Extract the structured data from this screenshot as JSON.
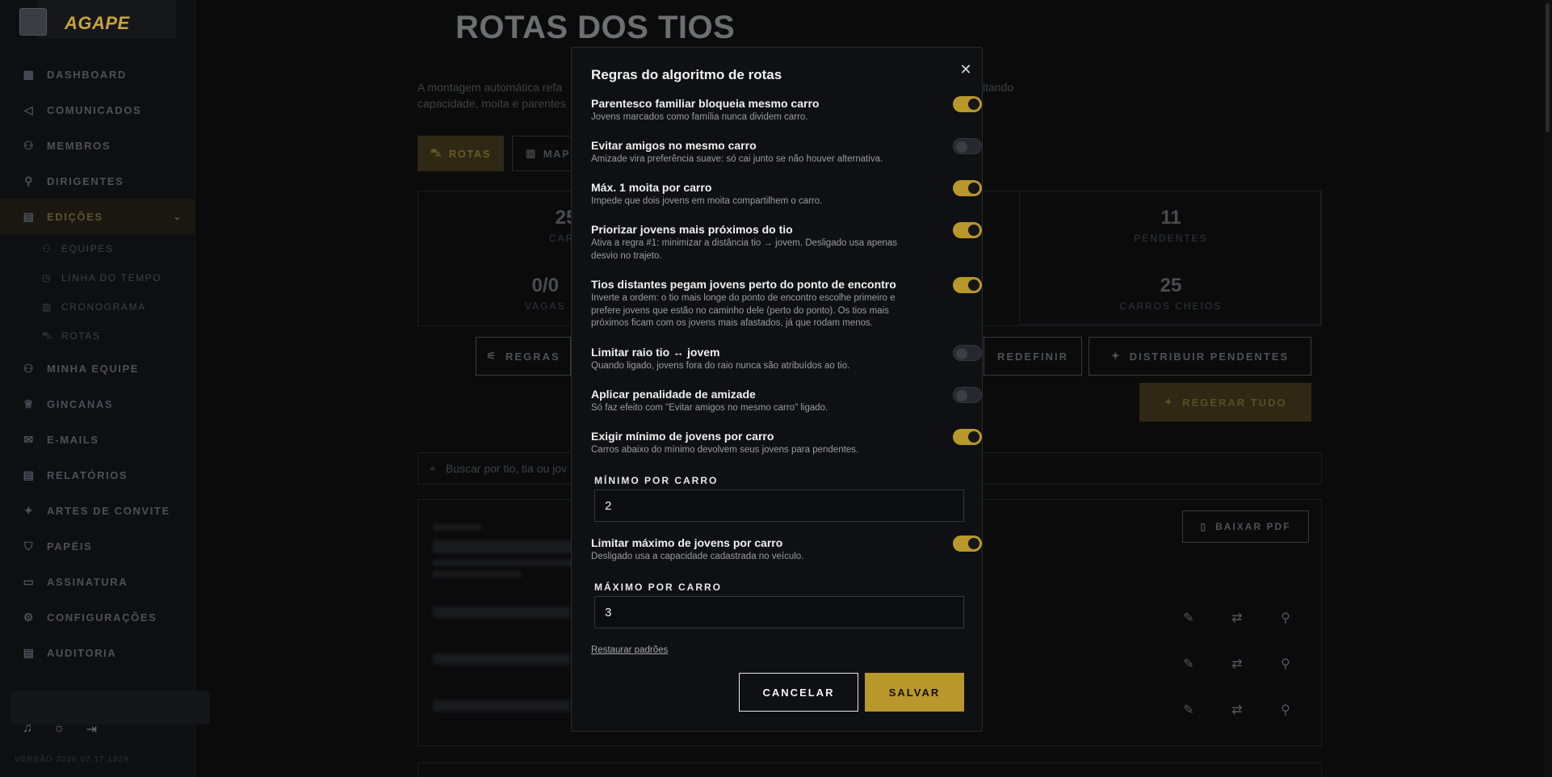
{
  "sidebar": {
    "brand": "AGAPE",
    "items": [
      {
        "label": "DASHBOARD",
        "icon": "grid-icon"
      },
      {
        "label": "COMUNICADOS",
        "icon": "megaphone-icon"
      },
      {
        "label": "MEMBROS",
        "icon": "users-icon"
      },
      {
        "label": "DIRIGENTES",
        "icon": "user-key-icon"
      },
      {
        "label": "EDIÇÕES",
        "icon": "calendar-icon"
      },
      {
        "label": "MINHA EQUIPE",
        "icon": "users-icon"
      },
      {
        "label": "GINCANAS",
        "icon": "trophy-icon"
      },
      {
        "label": "E-MAILS",
        "icon": "mail-icon"
      },
      {
        "label": "RELATÓRIOS",
        "icon": "report-icon"
      },
      {
        "label": "ARTES DE CONVITE",
        "icon": "sparkles-icon"
      },
      {
        "label": "PAPÉIS",
        "icon": "shield-icon"
      },
      {
        "label": "ASSINATURA",
        "icon": "card-icon"
      },
      {
        "label": "CONFIGURAÇÕES",
        "icon": "gear-icon"
      },
      {
        "label": "AUDITORIA",
        "icon": "audit-icon"
      }
    ],
    "sub_items": [
      {
        "label": "EQUIPES"
      },
      {
        "label": "LINHA DO TEMPO"
      },
      {
        "label": "CRONOGRAMA"
      },
      {
        "label": "ROTAS"
      }
    ],
    "version": "VERSÃO 2026.07.17.1829"
  },
  "main": {
    "title": "ROTAS DOS TIOS",
    "desc_left_1": "A montagem automática refa",
    "desc_right_1": "itando",
    "desc_left_2": "capacidade, moita e parentes",
    "tab_rotas": "ROTAS",
    "tab_mapa": "MAP",
    "stats": {
      "carros_num": "25",
      "carros_lbl": "CARR",
      "vagas_num": "0/0",
      "vagas_lbl": "VAGAS",
      "pendentes_num": "11",
      "pendentes_lbl": "PENDENTES",
      "cheios_num": "25",
      "cheios_lbl": "CARROS CHEIOS"
    },
    "btn_regras": "REGRAS",
    "btn_redefinir": "REDEFINIR",
    "btn_distribuir": "DISTRIBUIR PENDENTES",
    "btn_regerar": "REGERAR TUDO",
    "search_placeholder": "Buscar por tio, tia ou jov",
    "btn_pdf": "BAIXAR PDF"
  },
  "modal": {
    "title": "Regras do algoritmo de rotas",
    "rules": [
      {
        "title": "Parentesco familiar bloqueia mesmo carro",
        "desc": "Jovens marcados como família nunca dividem carro.",
        "on": true
      },
      {
        "title": "Evitar amigos no mesmo carro",
        "desc": "Amizade vira preferência suave: só cai junto se não houver alternativa.",
        "on": false
      },
      {
        "title": "Máx. 1 moita por carro",
        "desc": "Impede que dois jovens em moita compartilhem o carro.",
        "on": true
      },
      {
        "title": "Priorizar jovens mais próximos do tio",
        "desc": "Ativa a regra #1: minimizar a distância tio → jovem. Desligado usa apenas desvio no trajeto.",
        "on": true
      },
      {
        "title": "Tios distantes pegam jovens perto do ponto de encontro",
        "desc": "Inverte a ordem: o tio mais longe do ponto de encontro escolhe primeiro e prefere jovens que estão no caminho dele (perto do ponto). Os tios mais próximos ficam com os jovens mais afastados, já que rodam menos.",
        "on": true
      },
      {
        "title": "Limitar raio tio ↔ jovem",
        "desc": "Quando ligado, jovens fora do raio nunca são atribuídos ao tio.",
        "on": false
      },
      {
        "title": "Aplicar penalidade de amizade",
        "desc": "Só faz efeito com \"Evitar amigos no mesmo carro\" ligado.",
        "on": false
      },
      {
        "title": "Exigir mínimo de jovens por carro",
        "desc": "Carros abaixo do mínimo devolvem seus jovens para pendentes.",
        "on": true
      },
      {
        "title": "Limitar máximo de jovens por carro",
        "desc": "Desligado usa a capacidade cadastrada no veículo.",
        "on": true
      }
    ],
    "min_label": "MÍNIMO POR CARRO",
    "min_value": "2",
    "max_label": "MÁXIMO POR CARRO",
    "max_value": "3",
    "restore": "Restaurar padrões",
    "cancel": "CANCELAR",
    "save": "SALVAR"
  },
  "colors": {
    "accent": "#b8972c",
    "background": "#0b0b0c"
  }
}
